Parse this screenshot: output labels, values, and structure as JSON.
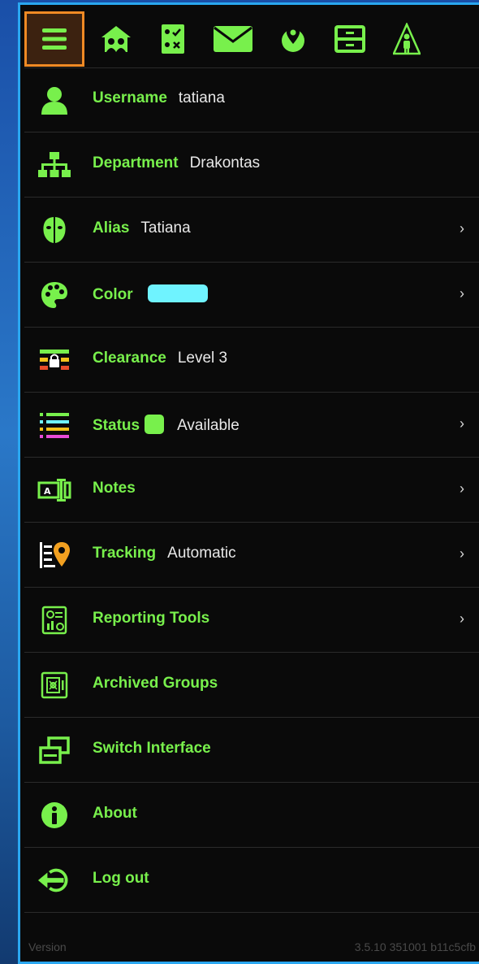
{
  "topbar": {
    "icons": [
      "menu-icon",
      "team-home-icon",
      "checklist-icon",
      "mail-icon",
      "map-pin-globe-icon",
      "cabinet-icon",
      "person-alert-icon"
    ]
  },
  "profile": {
    "username_label": "Username",
    "username_value": "tatiana",
    "department_label": "Department",
    "department_value": "Drakontas",
    "alias_label": "Alias",
    "alias_value": "Tatiana",
    "color_label": "Color",
    "color_value": "#6ff3ff",
    "clearance_label": "Clearance",
    "clearance_value": "Level 3",
    "status_label": "Status",
    "status_color": "#78f04c",
    "status_value": "Available",
    "notes_label": "Notes",
    "tracking_label": "Tracking",
    "tracking_value": "Automatic",
    "reporting_label": "Reporting Tools",
    "archived_label": "Archived Groups",
    "switch_label": "Switch Interface",
    "about_label": "About",
    "logout_label": "Log out"
  },
  "footer": {
    "version_label": "Version",
    "build": "3.5.10 351001 b11c5cfb"
  },
  "colors": {
    "accent": "#78f04c",
    "highlight": "#f08a24",
    "frame": "#2aa7f0"
  }
}
